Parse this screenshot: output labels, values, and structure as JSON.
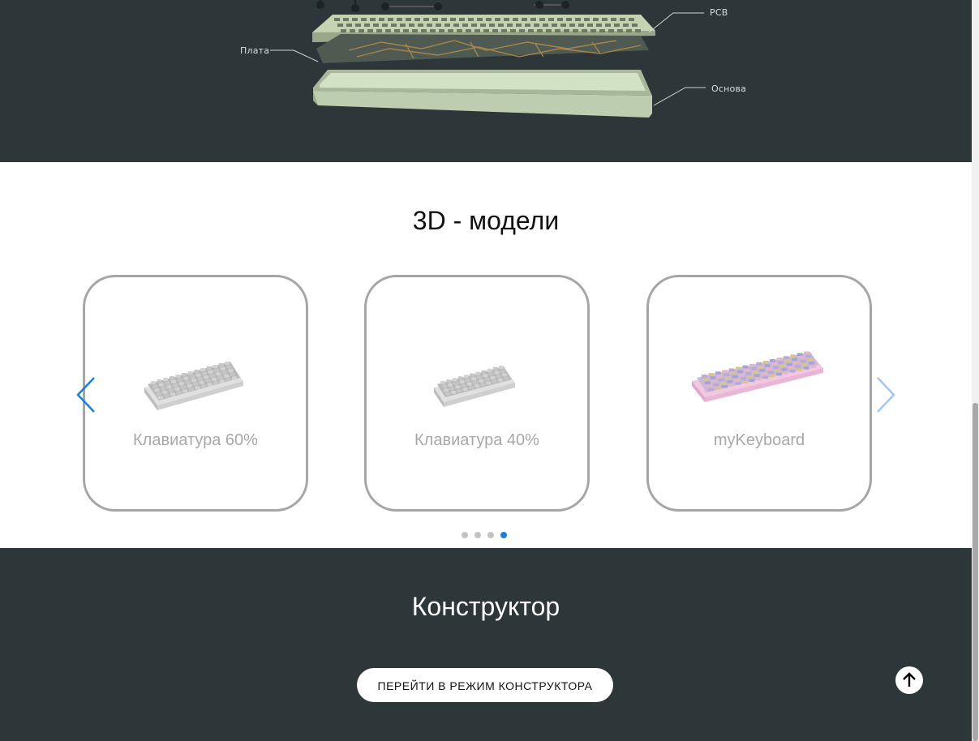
{
  "hero": {
    "labels": {
      "pcb": "PCB",
      "plate": "Плата",
      "base": "Основа"
    },
    "colors": {
      "background": "#2d3639",
      "plate": "#b8c9a5",
      "base": "#c9dcbc"
    }
  },
  "models": {
    "title": "3D - модели",
    "cards": [
      {
        "label": "Клавиатура 60%",
        "icon": "keyboard-60-icon"
      },
      {
        "label": "Клавиатура 40%",
        "icon": "keyboard-40-icon"
      },
      {
        "label": "myKeyboard",
        "icon": "keyboard-custom-icon"
      }
    ],
    "carousel": {
      "pages": 4,
      "active_page": 4,
      "accent": "#1a7fe0"
    }
  },
  "constructor": {
    "title": "Конструктор",
    "button_label": "ПЕРЕЙТИ В РЕЖИМ КОНСТРУКТОРА"
  }
}
